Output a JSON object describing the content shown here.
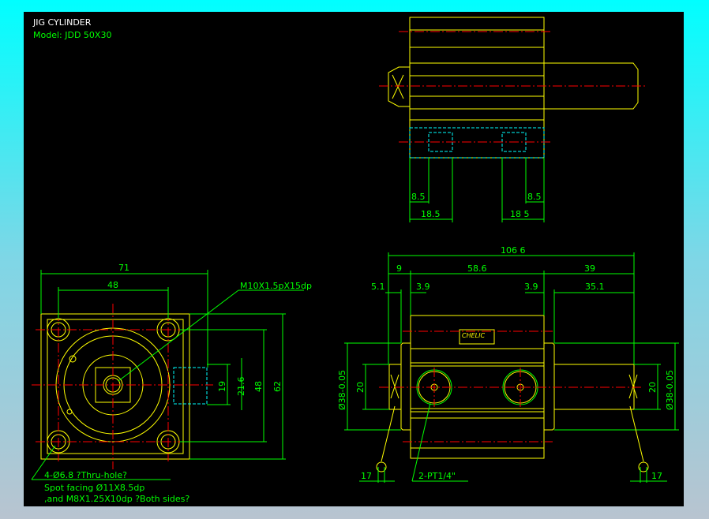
{
  "title": {
    "name": "JIG CYLINDER",
    "model": "Model: JDD 50X30"
  },
  "colors": {
    "background": "#000000",
    "outline": "#ffff00",
    "dimension": "#00ff00",
    "centerline": "#ff0000",
    "hidden": "#00ffff",
    "frame": "#00ffff"
  },
  "top_view": {
    "dims": {
      "left_small": "8.5",
      "right_small": "8.5",
      "left_large": "18.5",
      "right_large": "18 5"
    }
  },
  "side_view": {
    "dims": {
      "width": "71",
      "hole_pitch": "48",
      "port_19": "19",
      "port_216": "21.6",
      "v_pitch": "48",
      "height": "62"
    },
    "thread_note": "M10X1.5pX15dp",
    "notes": [
      "4-Ø6.8 ?Thru-hole?",
      "Spot facing  Ø11X8.5dp",
      ",and M8X1.25X10dp ?Both sides?"
    ]
  },
  "front_view": {
    "dims": {
      "overall": "106 6",
      "d9": "9",
      "d586": "58.6",
      "d39": "39",
      "d51": "5.1",
      "d39a": "3.9",
      "d39b": "3.9",
      "d351": "35.1",
      "dia_left": "Ø38-0.05",
      "rod_left": "20",
      "rod_right": "20",
      "dia_right": "Ø38-0.05",
      "wrench_left": "17",
      "wrench_right": "17"
    },
    "port_note": "2-PT1/4\"",
    "logo": "CHELIC"
  }
}
